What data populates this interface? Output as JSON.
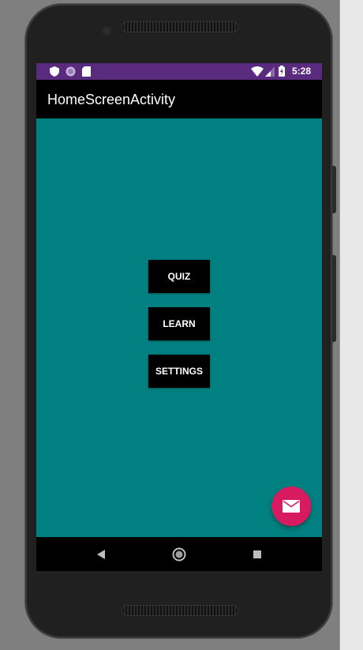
{
  "status_bar": {
    "time": "5:28",
    "left_icons": [
      "shield-icon",
      "circle-icon",
      "sd-card-icon"
    ],
    "right_icons": [
      "wifi-icon",
      "signal-icon",
      "battery-charging-icon"
    ],
    "color": "#5a2a7e"
  },
  "app_bar": {
    "title": "HomeScreenActivity",
    "color": "#000000"
  },
  "main": {
    "background": "#008080",
    "buttons": [
      {
        "label": "QUIZ"
      },
      {
        "label": "LEARN"
      },
      {
        "label": "SETTINGS"
      }
    ]
  },
  "fab": {
    "icon": "mail-icon",
    "color": "#d81b60"
  },
  "nav_bar": {
    "icons": [
      "back-icon",
      "home-icon",
      "recents-icon"
    ]
  }
}
